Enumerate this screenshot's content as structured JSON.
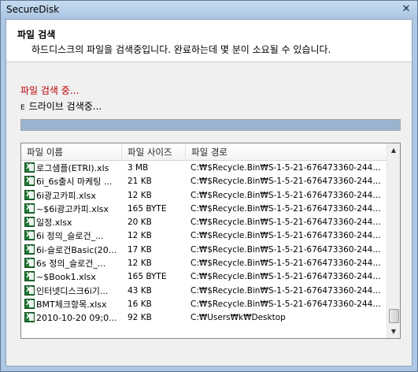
{
  "window": {
    "title": "SecureDisk",
    "close_label": "✕"
  },
  "header": {
    "title": "파일 검색",
    "description": "하드디스크의 파일을 검색중입니다. 완료하는데 몇 분이 소요될 수 있습니다."
  },
  "status": {
    "searching": "파일 검색 중...",
    "drive_letter": "E",
    "drive_text": "드라이브 검색중..."
  },
  "progress": {
    "percent": 100
  },
  "table": {
    "columns": [
      "파일 이름",
      "파일 사이즈",
      "파일 경로"
    ],
    "rows": [
      {
        "name": "로그샘플(ETRI).xls",
        "size": "3 MB",
        "path": "C:₩$Recycle.Bin₩S-1-5-21-676473360-2446..."
      },
      {
        "name": "6i_6s출시 마케팅 ...",
        "size": "21 KB",
        "path": "C:₩$Recycle.Bin₩S-1-5-21-676473360-2446..."
      },
      {
        "name": "6i광고카피.xlsx",
        "size": "12 KB",
        "path": "C:₩$Recycle.Bin₩S-1-5-21-676473360-2446..."
      },
      {
        "name": "~$6i광고카피.xlsx",
        "size": "165 BYTE",
        "path": "C:₩$Recycle.Bin₩S-1-5-21-676473360-2446..."
      },
      {
        "name": "일정.xlsx",
        "size": "20 KB",
        "path": "C:₩$Recycle.Bin₩S-1-5-21-676473360-2446..."
      },
      {
        "name": "6i 정의_슬로건_...",
        "size": "12 KB",
        "path": "C:₩$Recycle.Bin₩S-1-5-21-676473360-2446..."
      },
      {
        "name": "6i-슬로건Basic(200...",
        "size": "17 KB",
        "path": "C:₩$Recycle.Bin₩S-1-5-21-676473360-2446..."
      },
      {
        "name": "6s 정의_슬로건_...",
        "size": "12 KB",
        "path": "C:₩$Recycle.Bin₩S-1-5-21-676473360-2446..."
      },
      {
        "name": "~$Book1.xlsx",
        "size": "165 BYTE",
        "path": "C:₩$Recycle.Bin₩S-1-5-21-676473360-2446..."
      },
      {
        "name": "인터넷디스크6i기...",
        "size": "43 KB",
        "path": "C:₩$Recycle.Bin₩S-1-5-21-676473360-2446..."
      },
      {
        "name": "BMT체크항목.xlsx",
        "size": "16 KB",
        "path": "C:₩$Recycle.Bin₩S-1-5-21-676473360-2446..."
      },
      {
        "name": "2010-10-20 09;00;...",
        "size": "92 KB",
        "path": "C:₩Users₩k₩Desktop"
      }
    ]
  },
  "icons": {
    "file": "excel-file-icon",
    "close": "close-icon"
  }
}
